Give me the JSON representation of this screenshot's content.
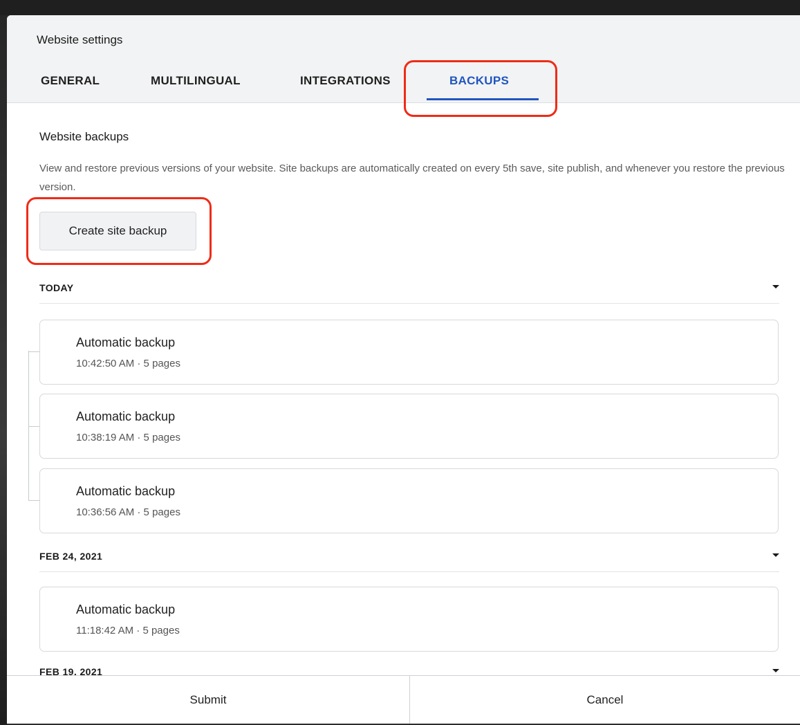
{
  "modal": {
    "title": "Website settings"
  },
  "tabs": [
    {
      "label": "GENERAL",
      "active": false
    },
    {
      "label": "MULTILINGUAL",
      "active": false
    },
    {
      "label": "INTEGRATIONS",
      "active": false
    },
    {
      "label": "BACKUPS",
      "active": true
    }
  ],
  "section": {
    "title": "Website backups",
    "description": "View and restore previous versions of your website. Site backups are automatically created on every 5th save, site publish, and whenever you restore the previous version.",
    "create_button": "Create site backup"
  },
  "groups": [
    {
      "label": "TODAY",
      "backups": [
        {
          "name": "Automatic backup",
          "meta": "10:42:50 AM · 5 pages"
        },
        {
          "name": "Automatic backup",
          "meta": "10:38:19 AM · 5 pages"
        },
        {
          "name": "Automatic backup",
          "meta": "10:36:56 AM · 5 pages"
        }
      ]
    },
    {
      "label": "FEB 24, 2021",
      "backups": [
        {
          "name": "Automatic backup",
          "meta": "11:18:42 AM · 5 pages"
        }
      ]
    },
    {
      "label": "FEB 19, 2021",
      "backups": []
    }
  ],
  "footer": {
    "submit_label": "Submit",
    "cancel_label": "Cancel"
  },
  "colors": {
    "accent": "#1f55c0",
    "highlight": "#ef2b16"
  }
}
